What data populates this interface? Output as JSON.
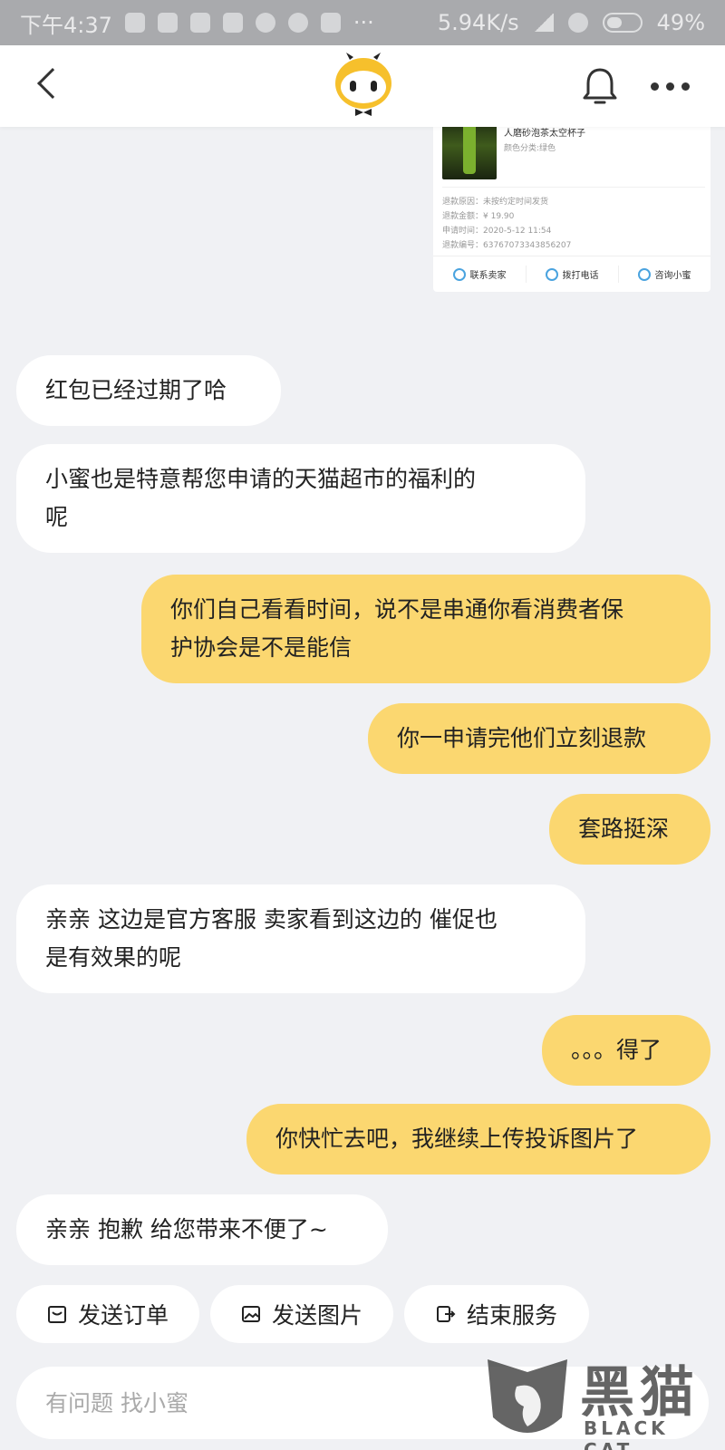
{
  "status_bar": {
    "time": "下午4:37",
    "net_speed": "5.94K/s",
    "battery": "49%"
  },
  "header": {
    "back_icon": "chevron-left-icon",
    "logo": "xiaomi-mascot-logo",
    "bell_icon": "bell-icon",
    "more_icon": "more-dots-icon"
  },
  "order_card": {
    "product_title": "人磨砂泡茶太空杯子",
    "product_spec": "颜色分类:绿色",
    "refund_reason": "退款原因：未按约定时间发货",
    "refund_amount": "退款金额：¥ 19.90",
    "apply_time": "申请时间：2020-5-12 11:54",
    "refund_no": "退款编号：63767073343856207",
    "actions": [
      {
        "label": "联系卖家",
        "icon": "chat-icon"
      },
      {
        "label": "拨打电话",
        "icon": "phone-icon"
      },
      {
        "label": "咨询小蜜",
        "icon": "mascot-icon"
      }
    ]
  },
  "messages": [
    {
      "from": "agent",
      "text": "红包已经过期了哈"
    },
    {
      "from": "agent",
      "text_l1": "小蜜也是特意帮您申请的天猫超市的福利的",
      "text_l2": "呢"
    },
    {
      "from": "user",
      "text_l1": "你们自己看看时间，说不是串通你看消费者保",
      "text_l2": "护协会是不是能信"
    },
    {
      "from": "user",
      "text": "你一申请完他们立刻退款"
    },
    {
      "from": "user",
      "text": "套路挺深"
    },
    {
      "from": "agent",
      "text_l1": "亲亲 这边是官方客服 卖家看到这边的 催促也",
      "text_l2": "是有效果的呢"
    },
    {
      "from": "user",
      "text": "。。。得了"
    },
    {
      "from": "user",
      "text": "你快忙去吧，我继续上传投诉图片了"
    },
    {
      "from": "agent",
      "text": "亲亲 抱歉 给您带来不便了~"
    }
  ],
  "quick_actions": [
    {
      "label": "发送订单",
      "icon": "order-icon"
    },
    {
      "label": "发送图片",
      "icon": "image-icon"
    },
    {
      "label": "结束服务",
      "icon": "exit-icon"
    }
  ],
  "input": {
    "placeholder": "有问题 找小蜜",
    "value": ""
  },
  "watermark": {
    "text": "黑猫",
    "sub": "BLACK CAT"
  },
  "colors": {
    "user_bubble": "#fbd770",
    "agent_bubble": "#ffffff",
    "background": "#f0f1f4"
  }
}
